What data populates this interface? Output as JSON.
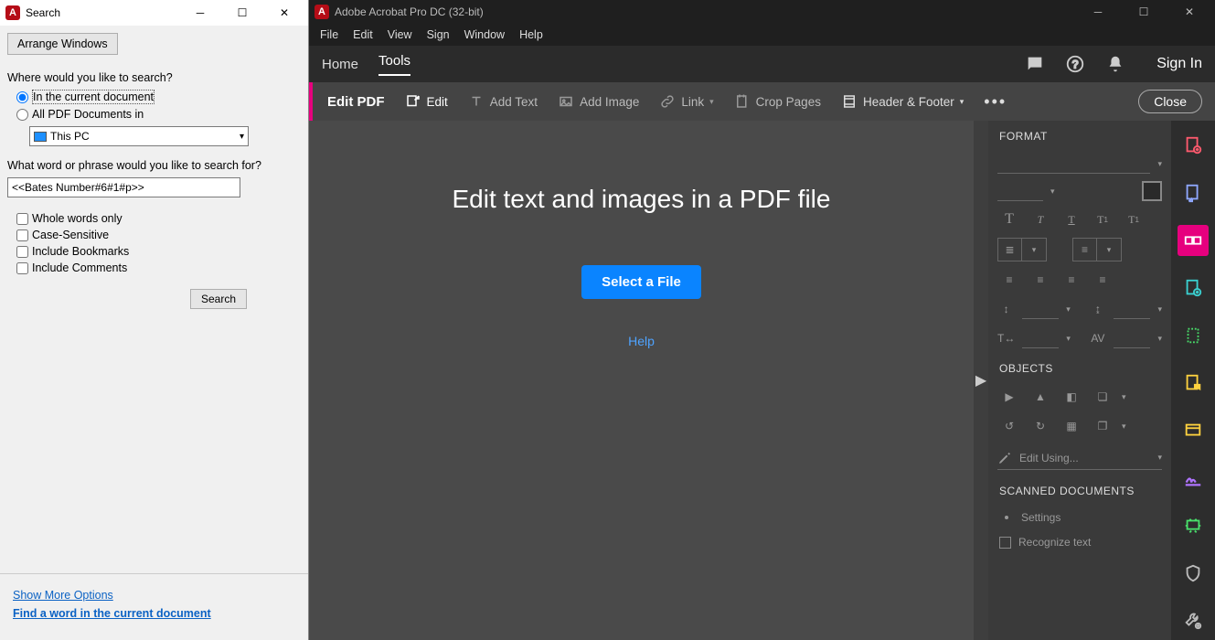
{
  "search": {
    "title": "Search",
    "arrange": "Arrange Windows",
    "q1": "Where would you like to search?",
    "r1": "In the current document",
    "r2": "All PDF Documents in",
    "scope": "This PC",
    "q2": "What word or phrase would you like to search for?",
    "term": "<<Bates Number#6#1#p>>",
    "c1": "Whole words only",
    "c2": "Case-Sensitive",
    "c3": "Include Bookmarks",
    "c4": "Include Comments",
    "btn": "Search",
    "more": "Show More Options",
    "find": "Find a word in the current document"
  },
  "main": {
    "title": "Adobe Acrobat Pro DC (32-bit)",
    "menu": [
      "File",
      "Edit",
      "View",
      "Sign",
      "Window",
      "Help"
    ],
    "tabs": {
      "home": "Home",
      "tools": "Tools"
    },
    "signin": "Sign In",
    "toolbar": {
      "title": "Edit PDF",
      "edit": "Edit",
      "addtext": "Add Text",
      "addimg": "Add Image",
      "link": "Link",
      "crop": "Crop Pages",
      "hf": "Header & Footer",
      "close": "Close"
    },
    "canvas": {
      "h": "Edit text and images in a PDF file",
      "btn": "Select a File",
      "help": "Help"
    },
    "fmt": {
      "format": "FORMAT",
      "objects": "OBJECTS",
      "editusing": "Edit Using...",
      "scanned": "SCANNED DOCUMENTS",
      "settings": "Settings",
      "recog": "Recognize text"
    }
  }
}
